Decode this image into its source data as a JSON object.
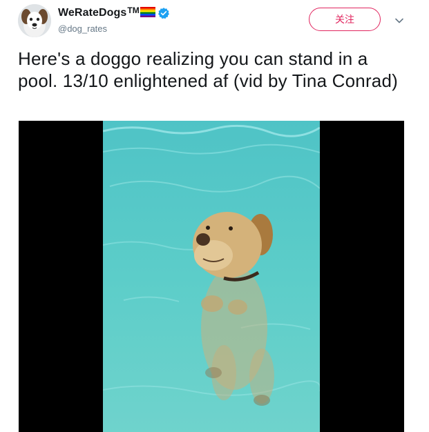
{
  "account": {
    "display_name": "WeRateDogs",
    "trademark": "TM",
    "handle": "@dog_rates",
    "badge_icon": "verified-badge-icon",
    "flag_icon": "rainbow-flag-icon"
  },
  "actions": {
    "follow_label": "关注",
    "more_icon": "chevron-down-icon"
  },
  "tweet": {
    "text": "Here's a doggo realizing you can stand in a pool. 13/10 enlightened af (vid by Tina Conrad)"
  },
  "colors": {
    "follow_accent": "#e0245e",
    "verified_blue": "#1da1f2",
    "handle_gray": "#657786",
    "pool_water": "#5cc8c8"
  }
}
